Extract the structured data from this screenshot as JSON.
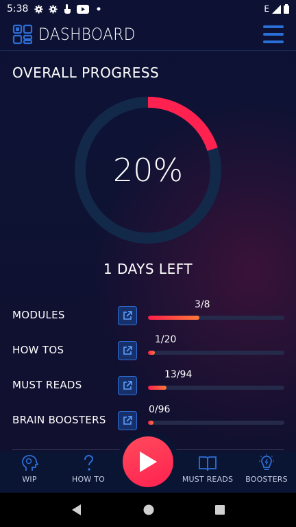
{
  "status_bar": {
    "time": "5:38",
    "network_label": "E",
    "icons": [
      "gear-icon",
      "gear-icon",
      "touch-icon",
      "youtube-icon",
      "dot-icon",
      "signal-icon",
      "battery-icon"
    ]
  },
  "app_bar": {
    "title": "DASHBOARD",
    "logo_icon": "grid-logo-icon",
    "menu_icon": "hamburger-menu-icon"
  },
  "overall": {
    "title": "OVERALL PROGRESS",
    "percent_label": "20%",
    "percent_value": 0.2,
    "days_left": "1 DAYS LEFT"
  },
  "progress_rows": [
    {
      "label": "MODULES",
      "count": "3/8",
      "fraction": 0.375
    },
    {
      "label": "HOW TOS",
      "count": "1/20",
      "fraction": 0.05
    },
    {
      "label": "MUST READS",
      "count": "13/94",
      "fraction": 0.138
    },
    {
      "label": "BRAIN BOOSTERS",
      "count": "0/96",
      "fraction": 0.0
    }
  ],
  "bottom_nav": {
    "items": [
      {
        "label": "WIP",
        "icon": "head-icon"
      },
      {
        "label": "HOW TO",
        "icon": "question-icon"
      },
      {
        "label": "MUST READS",
        "icon": "book-icon"
      },
      {
        "label": "BOOSTERS",
        "icon": "lightbulb-icon"
      }
    ],
    "play_icon": "play-icon"
  },
  "colors": {
    "accent_red": "#ff2150",
    "accent_orange": "#ff7a3a",
    "accent_blue": "#2d6fd8",
    "background": "#0d1235"
  }
}
